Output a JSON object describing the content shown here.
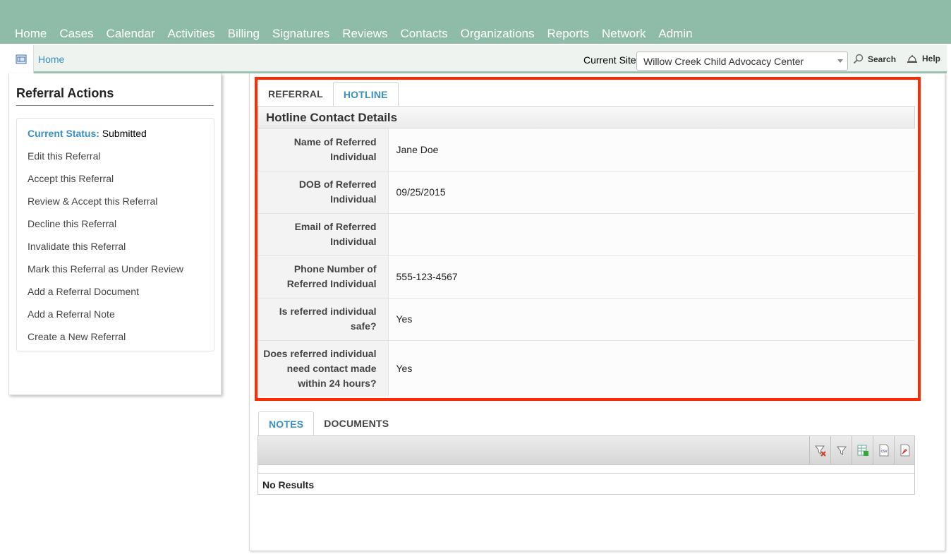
{
  "nav": {
    "items": [
      "Home",
      "Cases",
      "Calendar",
      "Activities",
      "Billing",
      "Signatures",
      "Reviews",
      "Contacts",
      "Organizations",
      "Reports",
      "Network",
      "Admin"
    ]
  },
  "breadcrumb": {
    "home": "Home"
  },
  "site": {
    "label": "Current Site",
    "value": "Willow Creek Child Advocacy Center"
  },
  "toolbar": {
    "search": "Search",
    "help": "Help"
  },
  "sidebar": {
    "title": "Referral Actions",
    "status_label": "Current Status:",
    "status_value": "Submitted",
    "actions": [
      "Edit this Referral",
      "Accept this Referral",
      "Review & Accept this Referral",
      "Decline this Referral",
      "Invalidate this Referral",
      "Mark this Referral as Under Review",
      "Add a Referral Document",
      "Add a Referral Note",
      "Create a New Referral"
    ]
  },
  "tabs_top": [
    {
      "label": "REFERRAL",
      "active": false
    },
    {
      "label": "HOTLINE",
      "active": true
    }
  ],
  "details": {
    "title": "Hotline Contact Details",
    "rows": [
      {
        "label": "Name of Referred Individual",
        "value": "Jane Doe"
      },
      {
        "label": "DOB of Referred Individual",
        "value": "09/25/2015"
      },
      {
        "label": "Email of Referred Individual",
        "value": ""
      },
      {
        "label": "Phone Number of Referred Individual",
        "value": "555-123-4567"
      },
      {
        "label": "Is referred individual safe?",
        "value": "Yes"
      },
      {
        "label": "Does referred individual need contact made within 24 hours?",
        "value": "Yes"
      }
    ]
  },
  "tabs_bottom": [
    {
      "label": "NOTES",
      "active": true
    },
    {
      "label": "DOCUMENTS",
      "active": false
    }
  ],
  "grid": {
    "icons": [
      "clear-filter-icon",
      "filter-icon",
      "export-excel-icon",
      "export-csv-icon",
      "export-pdf-icon"
    ],
    "csv_text": "csv",
    "empty": "No Results"
  },
  "colors": {
    "nav_bg": "#8fbca8",
    "link": "#3a8fc5",
    "highlight": "#ff2a00"
  }
}
